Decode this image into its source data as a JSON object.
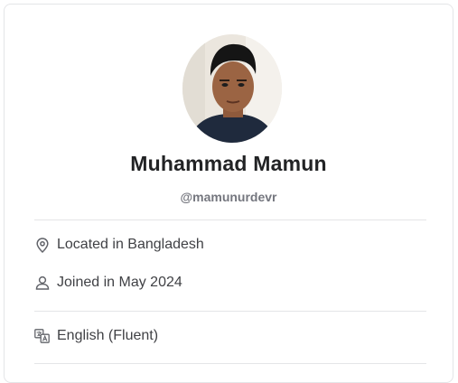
{
  "profile": {
    "name": "Muhammad Mamun",
    "username": "@mamunurdevr"
  },
  "details": {
    "location": "Located in Bangladesh",
    "joined": "Joined in May 2024",
    "language": "English (Fluent)"
  },
  "icons": {
    "location": "location-pin-icon",
    "joined": "user-icon",
    "language": "translate-icon"
  }
}
